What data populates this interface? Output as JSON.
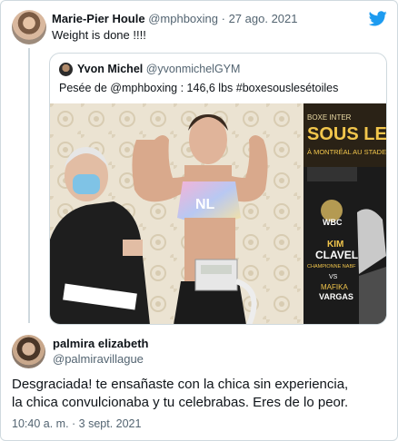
{
  "main_tweet": {
    "display_name": "Marie-Pier Houle",
    "handle": "@mphboxing",
    "separator": " · ",
    "date": "27 ago. 2021",
    "text": "Weight is done !!!!"
  },
  "quoted_tweet": {
    "display_name": "Yvon Michel",
    "handle": "@yvonmichelGYM",
    "text": "Pesée de @mphboxing : 146,6 lbs #boxesouslesétoiles",
    "photo": {
      "poster_lines": [
        "BOXE INTER",
        "SOUS LES",
        "À MONTRÉAL AU STADE"
      ],
      "belt_label": "WBC",
      "fighter_name": [
        "KIM",
        "CLAVEL"
      ],
      "fighter_sub": "CHAMPIONNE NABF",
      "vs": "VS",
      "opponent": [
        "MAFIKA",
        "VARGAS"
      ],
      "top_label": "NL"
    }
  },
  "reply": {
    "display_name": "palmira elizabeth",
    "handle": "@palmiravillague",
    "text_lines": [
      "Desgraciada! te ensañaste con la chica sin experiencia,",
      "la chica convulcionaba y tu celebrabas. Eres de lo peor."
    ],
    "time": "10:40 a. m.",
    "separator": " · ",
    "date": "3 sept. 2021"
  },
  "colors": {
    "twitter_blue": "#1d9bf0",
    "secondary_text": "#536471",
    "border": "#cfd9de"
  },
  "icons": {
    "brand": "twitter-bird-icon"
  }
}
